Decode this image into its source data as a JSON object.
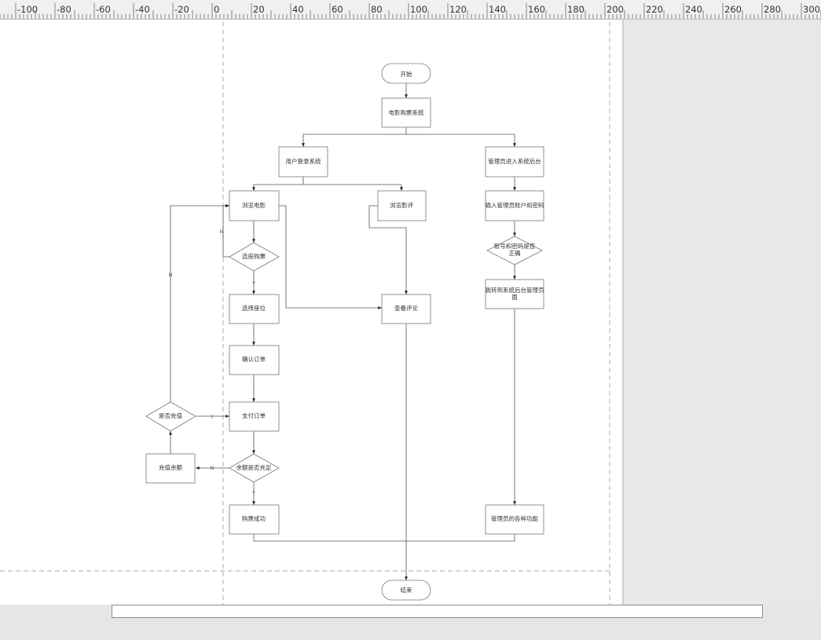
{
  "ruler": {
    "labels": [
      "-100",
      "-80",
      "-60",
      "-40",
      "-20",
      "0",
      "20",
      "40",
      "60",
      "80",
      "100",
      "120",
      "140",
      "160",
      "180",
      "200",
      "220",
      "240",
      "260",
      "280",
      "300"
    ]
  },
  "colors": {
    "stroke": "#777777",
    "text": "#333333",
    "page": "#ffffff",
    "workspace": "#e8e8e8"
  },
  "nodes": {
    "start": "开始",
    "system": "电影购票系统",
    "user_login": "用户登录系统",
    "admin_backend": "管理员进入系统后台",
    "browse_movies": "浏览电影",
    "browse_reviews": "浏览影评",
    "admin_input": "输入管理员账户和密码",
    "select_seat_purchase": "选座购票",
    "account_check_1": "账号和密码是否",
    "account_check_2": "正确",
    "select_seat": "选择座位",
    "view_comments": "查看评论",
    "jump_1": "跳转到系统后台管理页",
    "jump_2": "面",
    "confirm_order": "确认订单",
    "recharge_q": "是否充值",
    "pay_order": "支付订单",
    "recharge_balance": "充值余额",
    "balance_check": "余额是否充足",
    "purchase_success": "购票成功",
    "admin_functions": "管理员的各种功能",
    "end": "结束"
  },
  "edge_labels": {
    "seat_no": "N",
    "seat_yes": "Y",
    "recharge_no": "N",
    "recharge_yes": "Y",
    "balance_no": "N",
    "balance_yes": "Y"
  }
}
